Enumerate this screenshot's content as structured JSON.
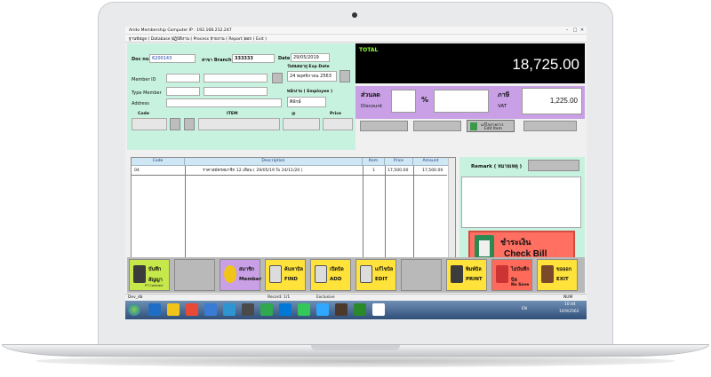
{
  "window": {
    "title": "Arido Membership  Computer IP : 192.168.212.247",
    "min": "–",
    "max": "□",
    "close": "✕"
  },
  "menu": [
    "ฐานข้อมูล ( Database )",
    "ปฏิบัติงาน ( Process )",
    "รายงาน ( Report )",
    "ออก ( Exit )"
  ],
  "form": {
    "doc_no_label": "Doc no.",
    "doc_no": "6200143",
    "branch_label": "สาขา Branch",
    "branch": "333333",
    "date_label": "Date",
    "date": "29/05/2019",
    "exp_label": "วันหมดอายุ Exp Date",
    "exp_date": "24 พฤศจิกายน 2563",
    "member_id_label": "Member ID",
    "type_member_label": "Type Member",
    "employee_label": "พนักงาน ( Employee )",
    "employee": "ศิลักษ์",
    "address_label": "Address",
    "code_label": "Code",
    "item_label": "ITEM",
    "at_label": "@",
    "price_label": "Price"
  },
  "total": {
    "label": "TOTAL",
    "value": "18,725.00"
  },
  "discount": {
    "th_label": "ส่วนลด",
    "en_label": "Discount",
    "percent": "%",
    "vat_th": "ภาษี",
    "vat_en": "VAT",
    "vat_value": "1,225.00"
  },
  "edit_item": {
    "th": "แก้ไขรายการ",
    "en": "Edit Item"
  },
  "grid": {
    "headers": [
      "Code",
      "Description",
      "Item",
      "Price",
      "Amount"
    ],
    "rows": [
      {
        "code": "04",
        "description": "ราคาสมัครสมาชิก 12 เดือน  ( 29/05/19 To 24/11/20 )",
        "item": "1",
        "price": "17,500.00",
        "amount": "17,500.00"
      }
    ]
  },
  "remark": {
    "label": "Remark ( หมายเหตุ )"
  },
  "check_bill": {
    "th": "ชำระเงิน",
    "en": "Check Bill"
  },
  "toolbar": [
    {
      "l1": "บันทึก",
      "l2": "สัญญา",
      "l3": "PT Contract",
      "bg": "#c7e84a"
    },
    {
      "l1": "",
      "l2": "",
      "l3": "",
      "bg": "#b9b9b9"
    },
    {
      "l1": "สมาชิก",
      "l2": "Member",
      "l3": "",
      "bg": "#c9a0e6"
    },
    {
      "l1": "ค้นหาบิล",
      "l2": "FIND",
      "l3": "",
      "bg": "#ffe23a"
    },
    {
      "l1": "เปิดบิล",
      "l2": "ADD",
      "l3": "",
      "bg": "#ffe23a"
    },
    {
      "l1": "แก้ไขบิล",
      "l2": "EDIT",
      "l3": "",
      "bg": "#ffe23a"
    },
    {
      "l1": "",
      "l2": "",
      "l3": "",
      "bg": "#b9b9b9"
    },
    {
      "l1": "พิมพ์บิล",
      "l2": "PRINT",
      "l3": "",
      "bg": "#ffe23a"
    },
    {
      "l1": "ไม่บันทึก",
      "l2": "บิล",
      "l3": "No Save",
      "bg": "#ff6a5a"
    },
    {
      "l1": "ขอออก",
      "l2": "EXIT",
      "l3": "",
      "bg": "#ffe23a"
    }
  ],
  "status": {
    "left": "Dev_db",
    "record": "Record: 1/1",
    "mode": "Exclusive",
    "num": "NUM"
  },
  "taskbar": {
    "lang": "EN",
    "time": "10:44",
    "date": "10/9/2562",
    "apps": [
      "#1f6ec6",
      "#f0c419",
      "#e84a35",
      "#3a7bd5",
      "#2e95d3",
      "#4a4a4a",
      "#2fa84f",
      "#0078d7",
      "#34c759",
      "#31a8ff",
      "#4b3a2b",
      "#2a8a2a",
      "#ffffff"
    ]
  }
}
